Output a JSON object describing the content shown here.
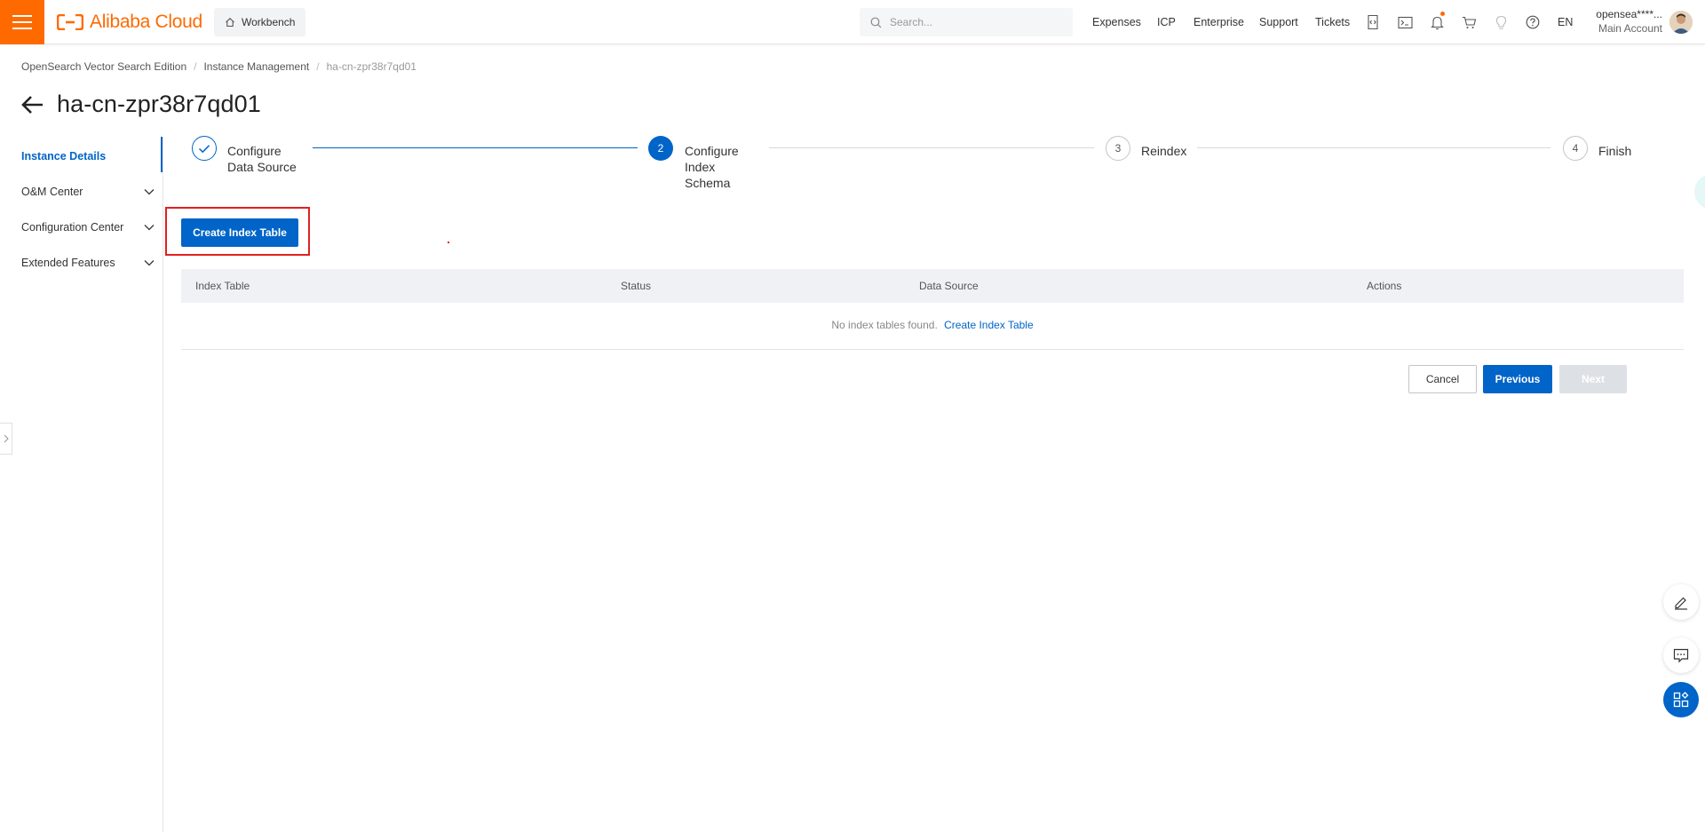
{
  "topbar": {
    "logo_text": "Alibaba Cloud",
    "workbench_label": "Workbench",
    "search_placeholder": "Search...",
    "nav": [
      "Expenses",
      "ICP",
      "Enterprise",
      "Support",
      "Tickets"
    ],
    "icons": [
      "code-icon",
      "terminal-icon",
      "bell-icon",
      "cart-icon",
      "bulb-icon",
      "help-icon"
    ],
    "lang": "EN",
    "user_name": "opensea****...",
    "user_role": "Main Account"
  },
  "breadcrumb": [
    "OpenSearch Vector Search Edition",
    "Instance Management",
    "ha-cn-zpr38r7qd01"
  ],
  "page_title": "ha-cn-zpr38r7qd01",
  "sidebar": {
    "items": [
      {
        "label": "Instance Details",
        "active": true,
        "expandable": false
      },
      {
        "label": "O&M Center",
        "active": false,
        "expandable": true
      },
      {
        "label": "Configuration Center",
        "active": false,
        "expandable": true
      },
      {
        "label": "Extended Features",
        "active": false,
        "expandable": true
      }
    ]
  },
  "steps": [
    {
      "number": "1",
      "label": "Configure Data Source",
      "state": "done"
    },
    {
      "number": "2",
      "label": "Configure Index Schema",
      "state": "current"
    },
    {
      "number": "3",
      "label": "Reindex",
      "state": "wait"
    },
    {
      "number": "4",
      "label": "Finish",
      "state": "wait"
    }
  ],
  "content": {
    "create_button": "Create Index Table",
    "table_columns": [
      "Index Table",
      "Status",
      "Data Source",
      "Actions"
    ],
    "empty_text": "No index tables found.",
    "empty_link": "Create Index Table"
  },
  "footer_buttons": {
    "cancel": "Cancel",
    "previous": "Previous",
    "next": "Next"
  },
  "colors": {
    "brand_orange": "#ff6a00",
    "primary_blue": "#0064c8",
    "highlight_red": "#e02020"
  }
}
